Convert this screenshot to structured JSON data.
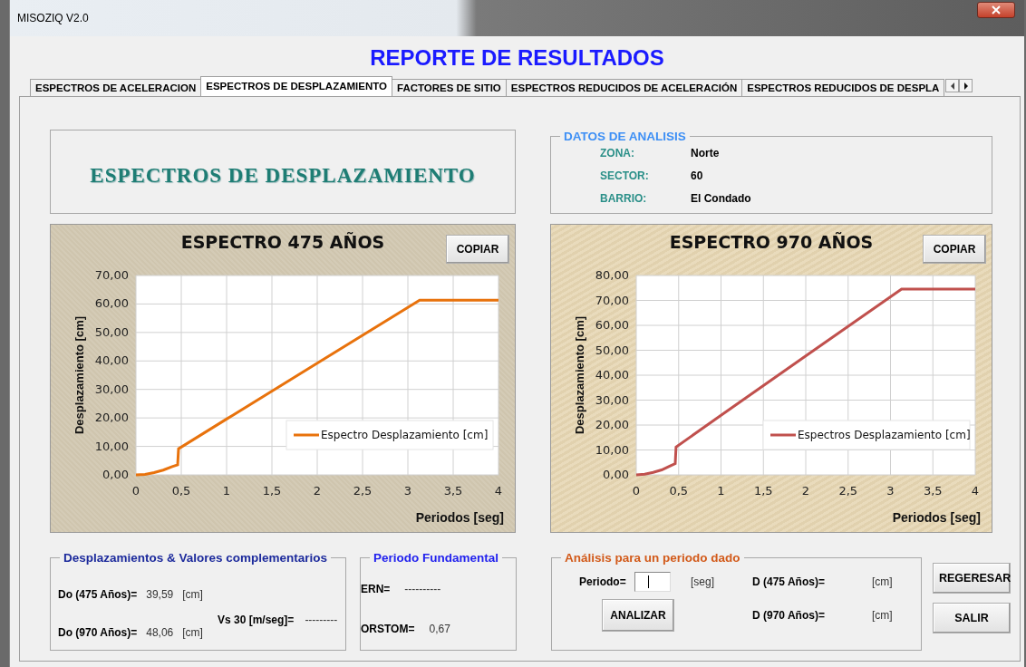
{
  "window": {
    "title": "MISOZIQ V2.0"
  },
  "heading": "REPORTE DE RESULTADOS",
  "tabs": [
    {
      "label": "ESPECTROS DE ACELERACION",
      "selected": false
    },
    {
      "label": "ESPECTROS DE DESPLAZAMIENTO",
      "selected": true
    },
    {
      "label": "FACTORES DE SITIO",
      "selected": false
    },
    {
      "label": "ESPECTROS REDUCIDOS DE ACELERACIÓN",
      "selected": false
    },
    {
      "label": "ESPECTROS REDUCIDOS DE DESPLA",
      "selected": false
    }
  ],
  "section_title": "ESPECTROS DE DESPLAZAMIENTO",
  "analysis_data": {
    "title": "DATOS DE ANALISIS",
    "fields": [
      {
        "label": "ZONA:",
        "value": "Norte"
      },
      {
        "label": "SECTOR:",
        "value": "60"
      },
      {
        "label": "BARRIO:",
        "value": "El Condado"
      }
    ]
  },
  "charts": [
    {
      "button": "COPIAR",
      "chart_data": {
        "type": "line",
        "grid": true,
        "title": "ESPECTRO 475 AÑOS",
        "xlabel": "Periodos [seg]",
        "ylabel": "Desplazamiento [cm]",
        "x": [
          0,
          0.1,
          0.2,
          0.3,
          0.4,
          0.46,
          0.47,
          1,
          2,
          3.13,
          4
        ],
        "series": [
          {
            "name": "Espectro Desplazamiento [cm]",
            "color": "#e8720c",
            "values": [
              0,
              0.2,
              0.8,
              1.7,
              2.9,
              3.5,
              9.2,
              19.6,
              39.2,
              61.3,
              61.3
            ]
          }
        ],
        "xlim": [
          0,
          4
        ],
        "ylim": [
          0,
          70
        ],
        "xticks": [
          {
            "value": 0,
            "label": "0"
          },
          {
            "value": 0.5,
            "label": "0,5"
          },
          {
            "value": 1,
            "label": "1"
          },
          {
            "value": 1.5,
            "label": "1,5"
          },
          {
            "value": 2,
            "label": "2"
          },
          {
            "value": 2.5,
            "label": "2,5"
          },
          {
            "value": 3,
            "label": "3"
          },
          {
            "value": 3.5,
            "label": "3,5"
          },
          {
            "value": 4,
            "label": "4"
          }
        ],
        "yticks": [
          {
            "value": 0,
            "label": "0,00"
          },
          {
            "value": 10,
            "label": "10,00"
          },
          {
            "value": 20,
            "label": "20,00"
          },
          {
            "value": 30,
            "label": "30,00"
          },
          {
            "value": 40,
            "label": "40,00"
          },
          {
            "value": 50,
            "label": "50,00"
          },
          {
            "value": 60,
            "label": "60,00"
          },
          {
            "value": 70,
            "label": "70,00"
          }
        ]
      }
    },
    {
      "button": "COPIAR",
      "chart_data": {
        "type": "line",
        "grid": true,
        "title": "ESPECTRO 970 AÑOS",
        "xlabel": "Periodos [seg]",
        "ylabel": "Desplazamiento [cm]",
        "x": [
          0,
          0.1,
          0.2,
          0.3,
          0.4,
          0.46,
          0.47,
          1,
          2,
          3.13,
          4
        ],
        "series": [
          {
            "name": "Espectros Desplazamiento [cm]",
            "color": "#c0504d",
            "values": [
              0,
              0.3,
              1,
              2,
              3.6,
              4.5,
              11.2,
              23.9,
              47.7,
              74.5,
              74.5
            ]
          }
        ],
        "xlim": [
          0,
          4
        ],
        "ylim": [
          0,
          80
        ],
        "xticks": [
          {
            "value": 0,
            "label": "0"
          },
          {
            "value": 0.5,
            "label": "0,5"
          },
          {
            "value": 1,
            "label": "1"
          },
          {
            "value": 1.5,
            "label": "1,5"
          },
          {
            "value": 2,
            "label": "2"
          },
          {
            "value": 2.5,
            "label": "2,5"
          },
          {
            "value": 3,
            "label": "3"
          },
          {
            "value": 3.5,
            "label": "3,5"
          },
          {
            "value": 4,
            "label": "4"
          }
        ],
        "yticks": [
          {
            "value": 0,
            "label": "0,00"
          },
          {
            "value": 10,
            "label": "10,00"
          },
          {
            "value": 20,
            "label": "20,00"
          },
          {
            "value": 30,
            "label": "30,00"
          },
          {
            "value": 40,
            "label": "40,00"
          },
          {
            "value": 50,
            "label": "50,00"
          },
          {
            "value": 60,
            "label": "60,00"
          },
          {
            "value": 70,
            "label": "70,00"
          },
          {
            "value": 80,
            "label": "80,00"
          }
        ]
      }
    }
  ],
  "displacements": {
    "title": "Desplazamientos & Valores complementarios",
    "rows": [
      {
        "label": "Do (475 Años)=",
        "value": "39,59",
        "unit": "[cm]"
      },
      {
        "label": "Do (970 Años)=",
        "value": "48,06",
        "unit": "[cm]"
      }
    ],
    "vs30": {
      "label": "Vs 30 [m/seg]=",
      "value": "---------"
    }
  },
  "fundamental_period": {
    "title": "Periodo Fundamental",
    "rows": [
      {
        "label": "ERN=",
        "value": "----------"
      },
      {
        "label": "ORSTOM=",
        "value": "0,67"
      }
    ]
  },
  "period_analysis": {
    "title": "Análisis para un periodo dado",
    "period_label": "Periodo=",
    "period_unit": "[seg]",
    "analyze_button": "ANALIZAR",
    "results": [
      {
        "label": "D (475 Años)=",
        "unit": "[cm]"
      },
      {
        "label": "D (970 Años)=",
        "unit": "[cm]"
      }
    ]
  },
  "buttons": [
    "REGERESAR",
    "SALIR"
  ]
}
